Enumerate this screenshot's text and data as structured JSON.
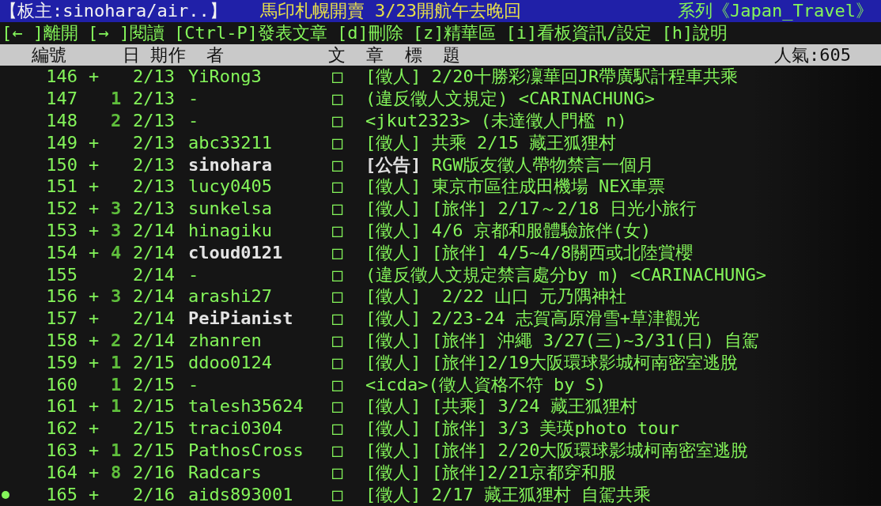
{
  "header": {
    "board_owner": "【板主:sinohara/air..】",
    "headline": "馬印札幌開賣 3/23開航午去晚回",
    "series": "系列《Japan_Travel》"
  },
  "menu": [
    "[← ]離開",
    "[→ ]閱讀",
    "[Ctrl-P]發表文章",
    "[d]刪除",
    "[z]精華區",
    "[i]看板資訊/設定",
    "[h]說明"
  ],
  "columns": [
    "編號",
    "日 期",
    "作  者",
    "文  章  標  題"
  ],
  "popularity": "人氣:605",
  "rows": [
    {
      "number": "146",
      "mark": "+",
      "date": "2/13",
      "author": "YiRong3",
      "highlight": false,
      "symbol": "□",
      "title": "[徵人] 2/20十勝彩凜華回JR帶廣駅計程車共乘",
      "selected": false
    },
    {
      "number": "147",
      "count": "1",
      "date": "2/13",
      "author": "-",
      "highlight": false,
      "symbol": "□",
      "title": "(違反徵人文規定) <CARINACHUNG>",
      "selected": false
    },
    {
      "number": "148",
      "count": "2",
      "date": "2/13",
      "author": "-",
      "highlight": false,
      "symbol": "□",
      "title": "<jkut2323> (未達徵人門檻 n)",
      "selected": false
    },
    {
      "number": "149",
      "mark": "+",
      "date": "2/13",
      "author": "abc33211",
      "highlight": false,
      "symbol": "□",
      "title": "[徵人] 共乘 2/15 藏王狐狸村",
      "selected": false
    },
    {
      "number": "150",
      "mark": "+",
      "date": "2/13",
      "author": "sinohara",
      "highlight": true,
      "symbol": "□",
      "title": "**[公告]** RGW版友徵人帶物禁言一個月",
      "selected": false
    },
    {
      "number": "151",
      "mark": "+",
      "date": "2/13",
      "author": "lucy0405",
      "highlight": false,
      "symbol": "□",
      "title": "[徵人] 東京市區往成田機場 NEX車票",
      "selected": false
    },
    {
      "number": "152",
      "mark": "+",
      "count": "3",
      "date": "2/13",
      "author": "sunkelsa",
      "highlight": false,
      "symbol": "□",
      "title": "[徵人] [旅伴] 2/17～2/18 日光小旅行",
      "selected": false
    },
    {
      "number": "153",
      "mark": "+",
      "count": "3",
      "date": "2/14",
      "author": "hinagiku",
      "highlight": false,
      "symbol": "□",
      "title": "[徵人] 4/6 京都和服體驗旅伴(女)",
      "selected": false
    },
    {
      "number": "154",
      "mark": "+",
      "count": "4",
      "date": "2/14",
      "author": "cloud0121",
      "highlight": true,
      "symbol": "□",
      "title": "[徵人] [旅伴] 4/5~4/8關西或北陸賞櫻",
      "selected": false
    },
    {
      "number": "155",
      "date": "2/14",
      "author": "-",
      "highlight": false,
      "symbol": "□",
      "title": "(違反徵人文規定禁言處分by m) <CARINACHUNG>",
      "selected": false
    },
    {
      "number": "156",
      "mark": "+",
      "count": "3",
      "date": "2/14",
      "author": "arashi27",
      "highlight": false,
      "symbol": "□",
      "title": "[徵人]  2/22 山口 元乃隅神社",
      "selected": false
    },
    {
      "number": "157",
      "mark": "+",
      "date": "2/14",
      "author": "PeiPianist",
      "highlight": true,
      "symbol": "□",
      "title": "[徵人] 2/23-24 志賀高原滑雪+草津觀光",
      "selected": false
    },
    {
      "number": "158",
      "mark": "+",
      "count": "2",
      "date": "2/14",
      "author": "zhanren",
      "highlight": false,
      "symbol": "□",
      "title": "[徵人] [旅伴] 沖繩 3/27(三)~3/31(日) 自駕",
      "selected": false
    },
    {
      "number": "159",
      "mark": "+",
      "count": "1",
      "date": "2/15",
      "author": "ddoo0124",
      "highlight": false,
      "symbol": "□",
      "title": "[徵人] [旅伴]2/19大阪環球影城柯南密室逃脫",
      "selected": false
    },
    {
      "number": "160",
      "count": "1",
      "date": "2/15",
      "author": "-",
      "highlight": false,
      "symbol": "□",
      "title": "<icda>(徵人資格不符 by S)",
      "selected": false
    },
    {
      "number": "161",
      "mark": "+",
      "count": "1",
      "date": "2/15",
      "author": "talesh35624",
      "highlight": false,
      "symbol": "□",
      "title": "[徵人] [共乘] 3/24 藏王狐狸村",
      "selected": false
    },
    {
      "number": "162",
      "mark": "+",
      "date": "2/15",
      "author": "traci0304",
      "highlight": false,
      "symbol": "□",
      "title": "[徵人] [旅伴] 3/3 美瑛photo tour",
      "selected": false
    },
    {
      "number": "163",
      "mark": "+",
      "count": "1",
      "date": "2/15",
      "author": "PathosCross",
      "highlight": false,
      "symbol": "□",
      "title": "[徵人] [旅伴] 2/20大阪環球影城柯南密室逃脫",
      "selected": false
    },
    {
      "number": "164",
      "mark": "+",
      "count": "8",
      "date": "2/16",
      "author": "Radcars",
      "highlight": false,
      "symbol": "□",
      "title": "[徵人] [旅伴]2/21京都穿和服",
      "selected": false
    },
    {
      "number": "165",
      "mark": "+",
      "date": "2/16",
      "author": "aids893001",
      "highlight": false,
      "symbol": "□",
      "title": "[徵人] 2/17 藏王狐狸村 自駕共乘",
      "selected": true
    }
  ]
}
